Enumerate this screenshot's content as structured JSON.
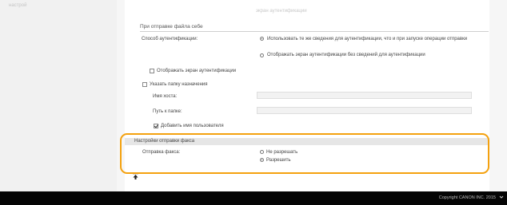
{
  "sidebar": {
    "label": "настрой"
  },
  "header": {
    "faded_text": "экран аутентификации"
  },
  "send_to_self": {
    "title": "При отправке файла себе",
    "auth_method_label": "Способ аутентификации:",
    "auth_options": [
      "Использовать те же сведения для аутентификации, что и при запуске операции отправки",
      "Отображать экран аутентификации без сведений для аутентификации"
    ],
    "auth_selected": 0,
    "show_auth_screen_label": "Отображать экран аутентификации",
    "show_auth_screen_checked": false,
    "specify_destination_label": "Указать папку назначения",
    "specify_destination_checked": false,
    "host_name_label": "Имя хоста:",
    "host_name_value": "",
    "folder_path_label": "Путь к папке:",
    "folder_path_value": "",
    "add_username_label": "Добавить имя пользователя",
    "add_username_checked": true
  },
  "fax_settings": {
    "title": "Настройки отправки факса",
    "fax_send_label": "Отправка факса:",
    "options": [
      "Не разрешать",
      "Разрешить"
    ],
    "selected": 1
  },
  "footer": {
    "copyright": "Copyright CANON INC. 2015"
  },
  "colors": {
    "highlight": "#f4a10e",
    "footer_bg": "#050505"
  }
}
